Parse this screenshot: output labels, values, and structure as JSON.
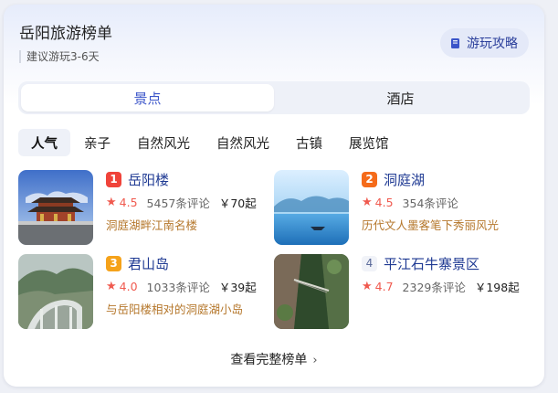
{
  "header": {
    "title": "岳阳旅游榜单",
    "subtitle": "建议游玩3-6天",
    "guide_button": "游玩攻略",
    "guide_icon": "book-icon"
  },
  "segment_tabs": [
    {
      "label": "景点",
      "active": true
    },
    {
      "label": "酒店",
      "active": false
    }
  ],
  "filter_chips": [
    {
      "label": "人气",
      "active": true
    },
    {
      "label": "亲子",
      "active": false
    },
    {
      "label": "自然风光",
      "active": false
    },
    {
      "label": "自然风光",
      "active": false
    },
    {
      "label": "古镇",
      "active": false
    },
    {
      "label": "展览馆",
      "active": false
    }
  ],
  "attractions": [
    {
      "rank": "1",
      "rank_color": "#f0433a",
      "name": "岳阳楼",
      "score": "4.5",
      "reviews": "5457条评论",
      "price": "￥70起",
      "desc": "洞庭湖畔江南名楼",
      "thumb_icon": "tower-photo"
    },
    {
      "rank": "2",
      "rank_color": "#f56b1a",
      "name": "洞庭湖",
      "score": "4.5",
      "reviews": "354条评论",
      "price": "",
      "desc": "历代文人墨客笔下秀丽风光",
      "thumb_icon": "lake-photo"
    },
    {
      "rank": "3",
      "rank_color": "#f5a21a",
      "name": "君山岛",
      "score": "4.0",
      "reviews": "1033条评论",
      "price": "￥39起",
      "desc": "与岳阳楼相对的洞庭湖小岛",
      "thumb_icon": "island-photo"
    },
    {
      "rank": "4",
      "rank_color": "",
      "name": "平江石牛寨景区",
      "score": "4.7",
      "reviews": "2329条评论",
      "price": "￥198起",
      "desc": "",
      "thumb_icon": "cliff-photo"
    }
  ],
  "footer": {
    "label": "查看完整榜单",
    "icon": "chevron-right-icon"
  }
}
